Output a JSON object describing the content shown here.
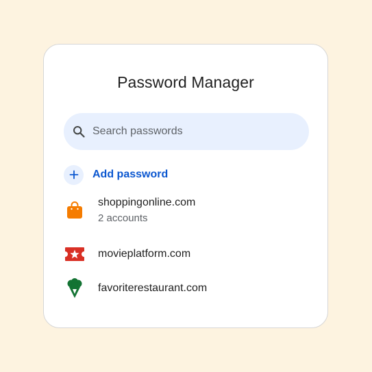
{
  "card": {
    "title": "Password Manager"
  },
  "search": {
    "placeholder": "Search passwords",
    "icon": "search-icon"
  },
  "add_password": {
    "label": "Add password",
    "icon": "plus-icon"
  },
  "sites": [
    {
      "name": "shoppingonline.com",
      "subtitle": "2 accounts",
      "icon": "shopping-bag-icon",
      "color": "#f57c00"
    },
    {
      "name": "movieplatform.com",
      "subtitle": "",
      "icon": "ticket-star-icon",
      "color": "#d93025"
    },
    {
      "name": "favoriterestaurant.com",
      "subtitle": "",
      "icon": "ice-cream-icon",
      "color": "#137333"
    }
  ],
  "colors": {
    "background": "#fdf3e0",
    "card": "#ffffff",
    "accent": "#0b57d0",
    "search_bg": "#e8f0fe"
  }
}
